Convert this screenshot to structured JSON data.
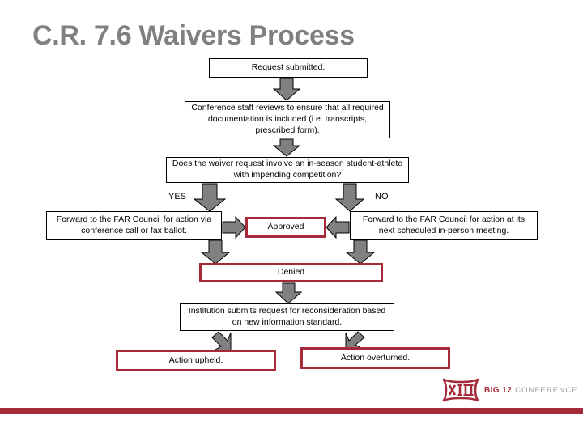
{
  "slide": {
    "title": "C.R. 7.6 Waivers Process",
    "background": "#ffffff"
  },
  "colors": {
    "accent_red": "#A52A3A",
    "title_gray": "#808080",
    "arrow_gray": "#808080",
    "box_black": "#000000"
  },
  "flow": {
    "boxes": [
      {
        "id": "request",
        "text": "Request submitted.",
        "border": "black"
      },
      {
        "id": "review",
        "text": "Conference staff reviews to ensure that all required documentation is included (i.e. transcripts, prescribed form).",
        "border": "black"
      },
      {
        "id": "decision",
        "text": "Does the waiver request involve an in-season student-athlete with impending competition?",
        "border": "black"
      },
      {
        "id": "yes_action",
        "text": "Forward to the FAR Council for action via conference call or fax ballot.",
        "border": "black"
      },
      {
        "id": "no_action",
        "text": "Forward to the FAR Council for action at its next scheduled in-person meeting.",
        "border": "black"
      },
      {
        "id": "approved",
        "text": "Approved",
        "border": "red"
      },
      {
        "id": "denied",
        "text": "Denied",
        "border": "red"
      },
      {
        "id": "reconsider",
        "text": "Institution submits request for reconsideration based on new information standard.",
        "border": "black"
      },
      {
        "id": "upheld",
        "text": "Action upheld.",
        "border": "red"
      },
      {
        "id": "overturned",
        "text": "Action overturned.",
        "border": "red"
      }
    ],
    "branch_labels": {
      "yes": "YES",
      "no": "NO"
    }
  },
  "logo": {
    "mark_text": "XII",
    "big12": "BIG 12",
    "conference": "CONFERENCE"
  }
}
